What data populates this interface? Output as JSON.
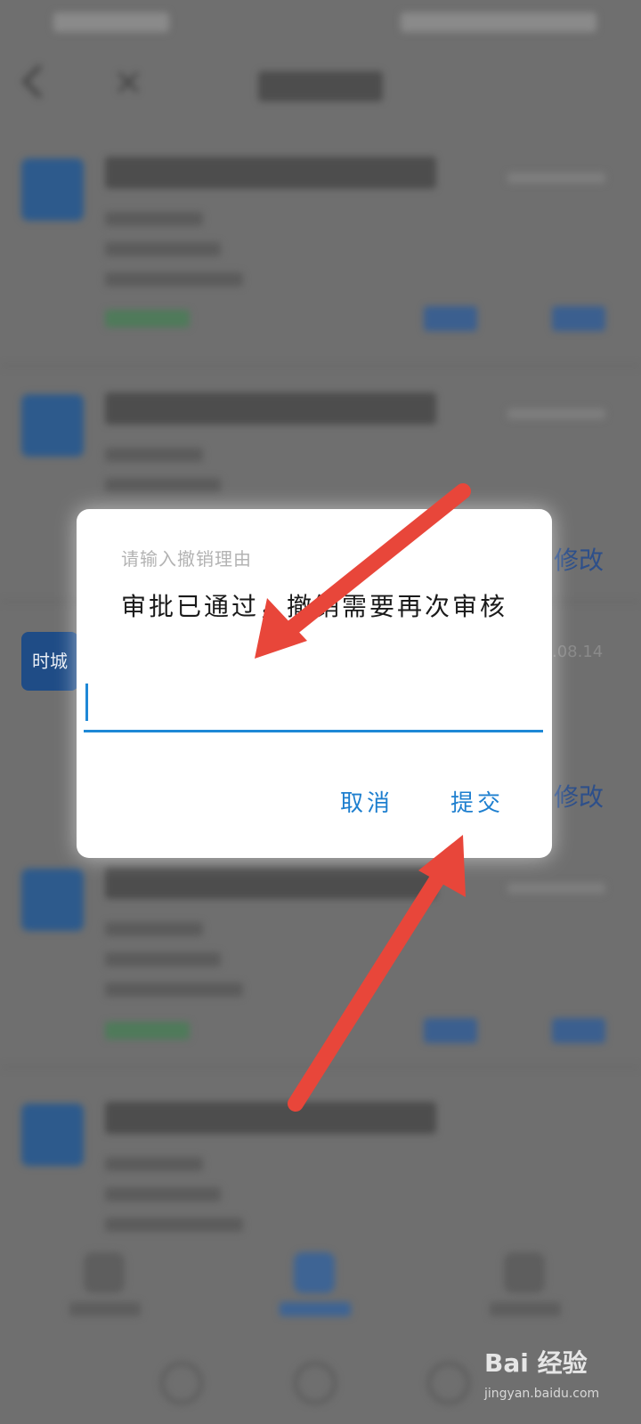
{
  "dialog": {
    "hint": "请输入撤销理由",
    "message": "审批已通过，撤销需要再次审核",
    "input_value": "",
    "cancel_label": "取消",
    "submit_label": "提交"
  },
  "background": {
    "edit_label": "修改",
    "chip_label": "时城",
    "date_partial": ".08.14"
  },
  "watermark": {
    "text": "Bai 经验",
    "sub": "jingyan.baidu.com"
  },
  "colors": {
    "accent": "#1e88d6",
    "arrow": "#e8463a",
    "overlay": "#6f6f6f"
  }
}
